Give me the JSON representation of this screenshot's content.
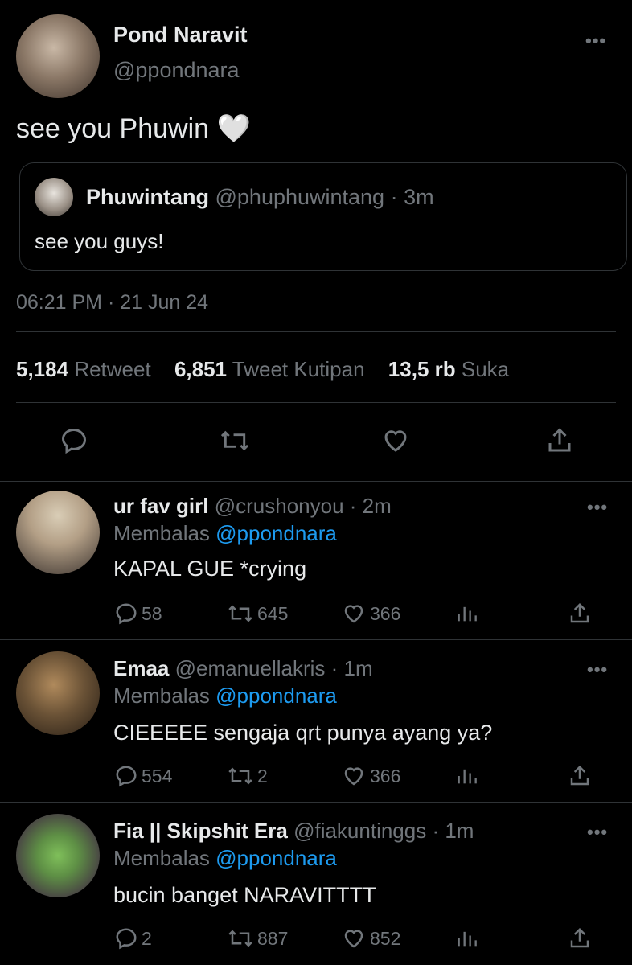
{
  "tweet": {
    "author_name": "Pond Naravit",
    "author_handle": "@ppondnara",
    "text": "see you Phuwin 🤍",
    "timestamp": "06:21 PM · 21 Jun 24",
    "quoted": {
      "name": "Phuwintang",
      "handle": "@phuphuwintang · 3m",
      "text": "see you guys!"
    },
    "stats": {
      "retweets": "5,184",
      "retweets_label": "Retweet",
      "quotes": "6,851",
      "quotes_label": "Tweet Kutipan",
      "likes": "13,5 rb",
      "likes_label": "Suka"
    },
    "more_icon": "more-icon"
  },
  "replies": [
    {
      "name": "ur fav girl",
      "meta": "@crushonyou · 2m",
      "replying_prefix": "Membalas ",
      "replying_to": "@ppondnara",
      "text": "KAPAL GUE *crying",
      "reply_count": "58",
      "retweet_count": "645",
      "like_count": "366"
    },
    {
      "name": "Emaa",
      "meta": "@emanuellakris · 1m",
      "replying_prefix": "Membalas ",
      "replying_to": "@ppondnara",
      "text": "CIEEEEE sengaja qrt punya ayang ya?",
      "reply_count": "554",
      "retweet_count": "2",
      "like_count": "366"
    },
    {
      "name": "Fia || Skipshit Era",
      "meta": "@fiakuntinggs · 1m",
      "replying_prefix": "Membalas ",
      "replying_to": "@ppondnara",
      "text": "bucin banget NARAVITTTT",
      "reply_count": "2",
      "retweet_count": "887",
      "like_count": "852"
    }
  ],
  "icons": {
    "more": "•••",
    "heart_emoji": "🤍"
  },
  "colors": {
    "background": "#000000",
    "text": "#e7e9ea",
    "muted": "#71767b",
    "link": "#1d9bf0",
    "border": "#2f3336"
  }
}
